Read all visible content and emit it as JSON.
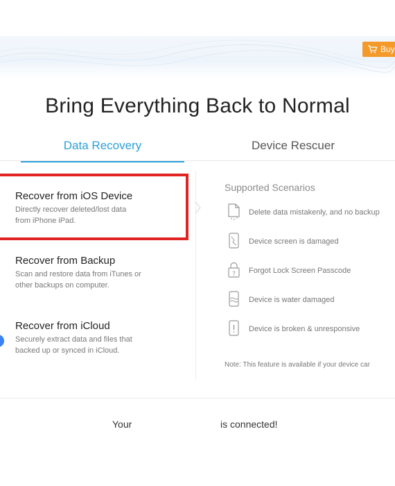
{
  "header": {
    "buy_label": "Buy",
    "accent_color": "#f39a2b"
  },
  "headline": "Bring Everything Back to Normal",
  "tabs": [
    {
      "label": "Data Recovery",
      "active": true
    },
    {
      "label": "Device Rescuer",
      "active": false
    }
  ],
  "options": [
    {
      "title": "Recover from iOS Device",
      "desc_line1": "Directly recover deleted/lost data",
      "desc_line2": "from iPhone iPad."
    },
    {
      "title": "Recover from Backup",
      "desc_line1": "Scan and restore data from iTunes or",
      "desc_line2": "other backups on computer."
    },
    {
      "title": "Recover from iCloud",
      "desc_line1": "Securely extract data and files that",
      "desc_line2": "backed up or synced in iCloud."
    }
  ],
  "scenarios": {
    "title": "Supported Scenarios",
    "items": [
      {
        "label": "Delete data mistakenly, and no backup",
        "icon": "file-delete-icon"
      },
      {
        "label": "Device screen is damaged",
        "icon": "broken-screen-icon"
      },
      {
        "label": "Forgot Lock Screen Passcode",
        "icon": "lock-question-icon"
      },
      {
        "label": "Device is water damaged",
        "icon": "water-damage-icon"
      },
      {
        "label": "Device is broken & unresponsive",
        "icon": "device-alert-icon"
      }
    ],
    "note": "Note: This feature is available if your device car"
  },
  "status": {
    "part1": "Your",
    "part2": "is connected!"
  },
  "colors": {
    "tab_active": "#2aa0d8",
    "highlight": "#e02424"
  }
}
